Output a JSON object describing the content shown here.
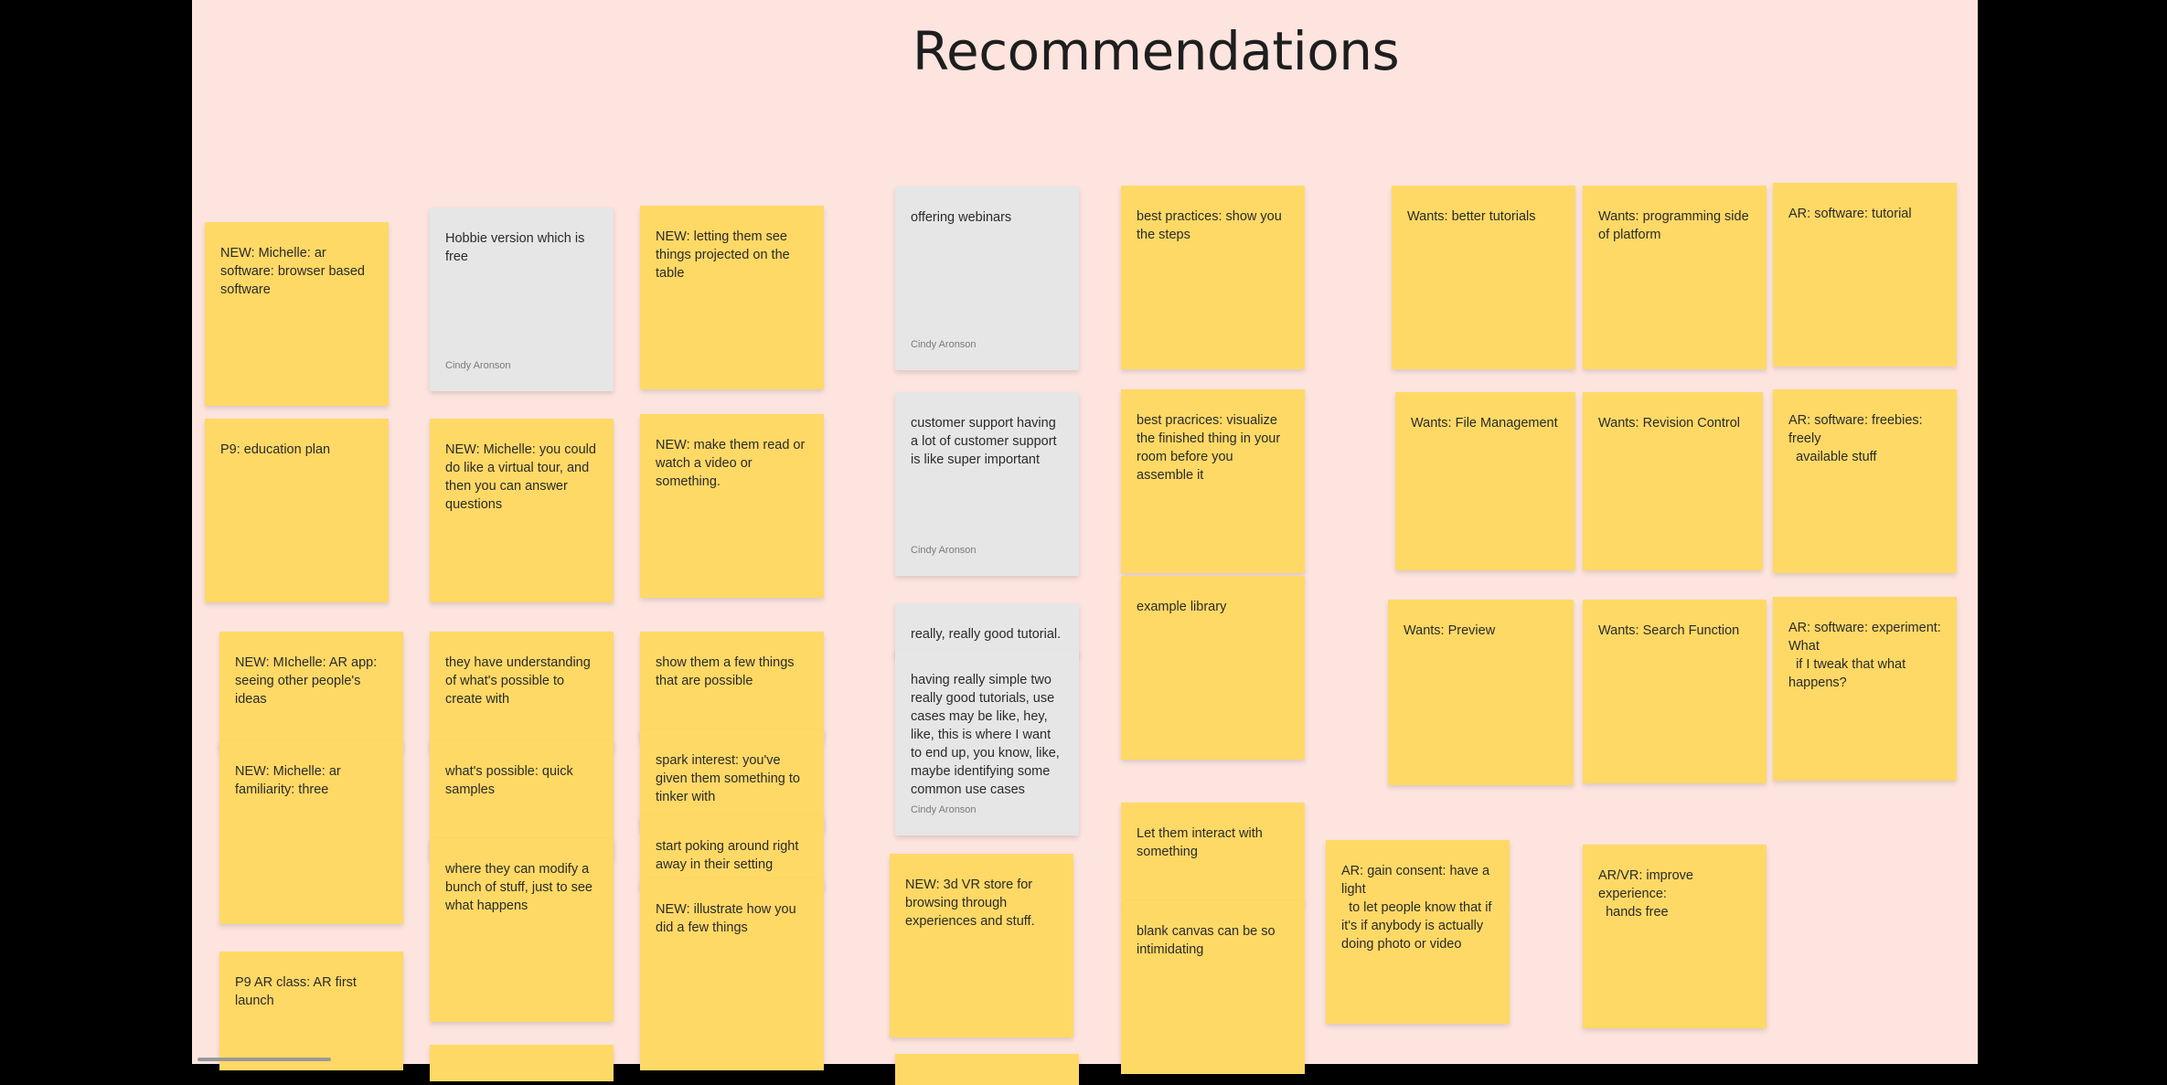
{
  "title": "Recommendations",
  "colors": {
    "sticky_yellow": "#ffd966",
    "sticky_gray": "#e6e6e6",
    "board": "#fde4df"
  },
  "notes": [
    {
      "text": "NEW: Michelle: ar software: browser based software"
    },
    {
      "text": "P9: education plan"
    },
    {
      "text": "NEW: MIchelle: AR app: seeing other people's ideas"
    },
    {
      "text": "NEW: Michelle: ar familiarity: three"
    },
    {
      "text": "P9 AR class: AR first launch"
    },
    {
      "text": "Hobbie version which is free",
      "author": "Cindy Aronson"
    },
    {
      "text": "NEW: Michelle: you could do like a virtual tour, and then you can answer questions"
    },
    {
      "text": "they have understanding of what's possible to create with"
    },
    {
      "text": "what's possible: quick samples"
    },
    {
      "text": "where they can modify a bunch of stuff, just to see what happens"
    },
    {
      "text": ""
    },
    {
      "text": "NEW: letting them see things projected on the table"
    },
    {
      "text": "NEW: make them read or watch a video or something."
    },
    {
      "text": "show them a few things that are possible"
    },
    {
      "text": "spark interest: you've given them something to tinker with"
    },
    {
      "text": "start poking around right away in their setting"
    },
    {
      "text": "NEW: illustrate how you did a few things"
    },
    {
      "text": "offering webinars",
      "author": "Cindy Aronson"
    },
    {
      "text": "customer support having a lot of customer support is like super important",
      "author": "Cindy Aronson"
    },
    {
      "text": "really, really good tutorial."
    },
    {
      "text": "having really simple two really good tutorials, use cases may be like, hey, like, this is where I want to end up, you know, like, maybe identifying some common use cases",
      "author": "Cindy Aronson"
    },
    {
      "text": "NEW: 3d VR store for browsing through experiences and stuff."
    },
    {
      "text": ""
    },
    {
      "text": "best practices: show you the steps"
    },
    {
      "text": "best pracrices: visualize the finished thing in your room before you assemble it"
    },
    {
      "text": "example library"
    },
    {
      "text": "Let them interact with something"
    },
    {
      "text": "blank canvas can be so intimidating"
    },
    {
      "text": "AR: gain consent: have a light\n  to let people know that if it's if anybody is actually doing photo or video"
    },
    {
      "text": "Wants: better tutorials"
    },
    {
      "text": "Wants: programming side of platform"
    },
    {
      "text": "AR: software: tutorial"
    },
    {
      "text": "Wants: File Management"
    },
    {
      "text": "Wants: Revision Control"
    },
    {
      "text": "AR: software: freebies: freely\n  available stuff"
    },
    {
      "text": "Wants: Preview"
    },
    {
      "text": "Wants: Search Function"
    },
    {
      "text": "AR: software: experiment: What\n  if I tweak that what happens?"
    },
    {
      "text": "AR/VR: improve experience:\n  hands free"
    }
  ]
}
